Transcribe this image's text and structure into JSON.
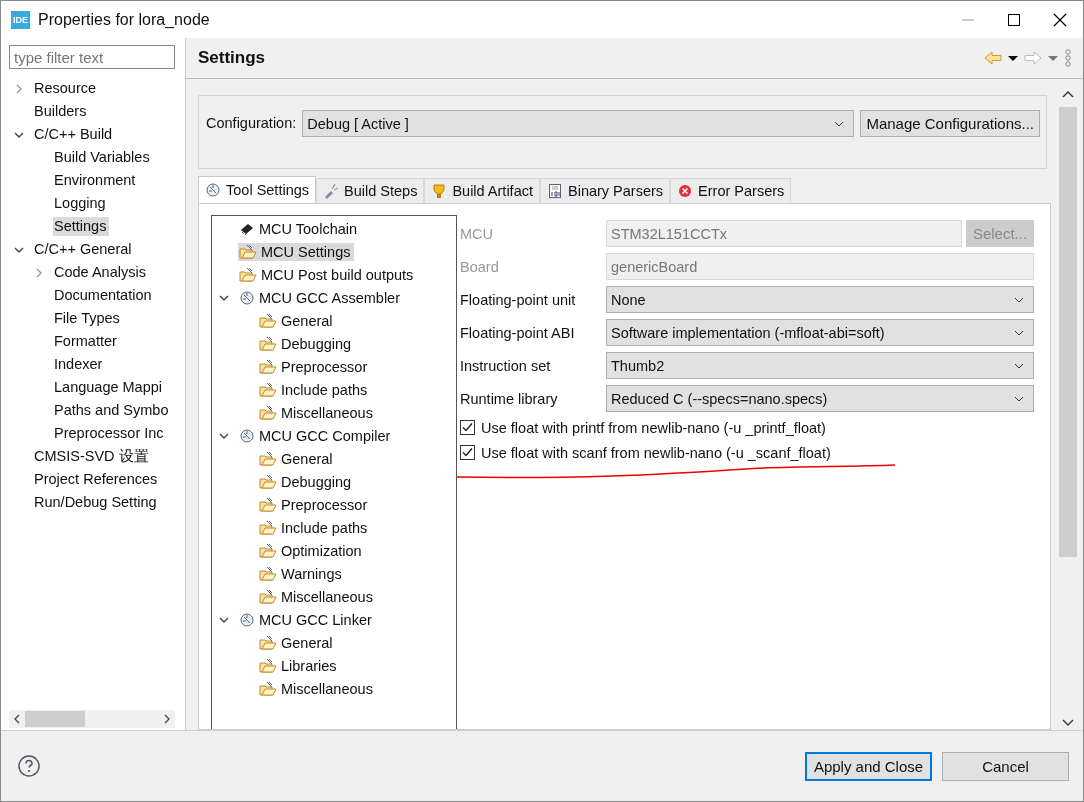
{
  "window": {
    "title": "Properties for lora_node",
    "app_icon": "IDE"
  },
  "sidebar": {
    "filter": {
      "placeholder": "type filter text"
    },
    "items": [
      {
        "label": "Resource",
        "selected": false,
        "expanded": false
      },
      {
        "label": "Builders",
        "selected": false
      },
      {
        "label": "C/C++ Build",
        "selected": false,
        "expanded": true,
        "children": [
          {
            "label": "Build Variables",
            "selected": false
          },
          {
            "label": "Environment",
            "selected": false
          },
          {
            "label": "Logging",
            "selected": false
          },
          {
            "label": "Settings",
            "selected": true
          }
        ]
      },
      {
        "label": "C/C++ General",
        "selected": false,
        "expanded": true,
        "children": [
          {
            "label": "Code Analysis",
            "selected": false,
            "expanded": false
          },
          {
            "label": "Documentation",
            "selected": false
          },
          {
            "label": "File Types",
            "selected": false
          },
          {
            "label": "Formatter",
            "selected": false
          },
          {
            "label": "Indexer",
            "selected": false
          },
          {
            "label": "Language Mappi",
            "selected": false
          },
          {
            "label": "Paths and Symbo",
            "selected": false
          },
          {
            "label": "Preprocessor Inc",
            "selected": false
          }
        ]
      },
      {
        "label": "CMSIS-SVD 设置",
        "selected": false
      },
      {
        "label": "Project References",
        "selected": false
      },
      {
        "label": "Run/Debug Setting",
        "selected": false
      }
    ]
  },
  "page": {
    "title": "Settings",
    "configuration": {
      "label": "Configuration:",
      "value": "Debug  [ Active ]",
      "button": "Manage Configurations..."
    },
    "tabs": [
      {
        "label": "Tool Settings",
        "kind": "gear",
        "selected": true
      },
      {
        "label": "Build Steps",
        "kind": "brush",
        "selected": false
      },
      {
        "label": "Build Artifact",
        "kind": "trophy",
        "selected": false
      },
      {
        "label": "Binary Parsers",
        "kind": "binary",
        "selected": false
      },
      {
        "label": "Error Parsers",
        "kind": "error",
        "selected": false
      }
    ],
    "tool_tree": [
      {
        "label": "MCU Toolchain",
        "kind": "chip",
        "selected": false
      },
      {
        "label": "MCU Settings",
        "kind": "folder",
        "selected": true
      },
      {
        "label": "MCU Post build outputs",
        "kind": "folder",
        "selected": false
      },
      {
        "label": "MCU GCC Assembler",
        "kind": "gear",
        "selected": false,
        "expanded": true,
        "children": [
          {
            "label": "General",
            "kind": "folder",
            "selected": false
          },
          {
            "label": "Debugging",
            "kind": "folder",
            "selected": false
          },
          {
            "label": "Preprocessor",
            "kind": "folder",
            "selected": false
          },
          {
            "label": "Include paths",
            "kind": "folder",
            "selected": false
          },
          {
            "label": "Miscellaneous",
            "kind": "folder",
            "selected": false
          }
        ]
      },
      {
        "label": "MCU GCC Compiler",
        "kind": "gear",
        "selected": false,
        "expanded": true,
        "children": [
          {
            "label": "General",
            "kind": "folder",
            "selected": false
          },
          {
            "label": "Debugging",
            "kind": "folder",
            "selected": false
          },
          {
            "label": "Preprocessor",
            "kind": "folder",
            "selected": false
          },
          {
            "label": "Include paths",
            "kind": "folder",
            "selected": false
          },
          {
            "label": "Optimization",
            "kind": "folder",
            "selected": false
          },
          {
            "label": "Warnings",
            "kind": "folder",
            "selected": false
          },
          {
            "label": "Miscellaneous",
            "kind": "folder",
            "selected": false
          }
        ]
      },
      {
        "label": "MCU GCC Linker",
        "kind": "gear",
        "selected": false,
        "expanded": true,
        "children": [
          {
            "label": "General",
            "kind": "folder",
            "selected": false
          },
          {
            "label": "Libraries",
            "kind": "folder",
            "selected": false
          },
          {
            "label": "Miscellaneous",
            "kind": "folder",
            "selected": false
          }
        ]
      }
    ],
    "fields": [
      {
        "kind": "text",
        "label": "MCU",
        "value": "STM32L151CCTx",
        "disabled": true,
        "button": "Select..."
      },
      {
        "kind": "text",
        "label": "Board",
        "value": "genericBoard",
        "disabled": true
      },
      {
        "kind": "select",
        "label": "Floating-point unit",
        "value": "None",
        "disabled": false
      },
      {
        "kind": "select",
        "label": "Floating-point ABI",
        "value": "Software implementation (-mfloat-abi=soft)",
        "disabled": false
      },
      {
        "kind": "select",
        "label": "Instruction set",
        "value": "Thumb2",
        "disabled": false
      },
      {
        "kind": "select",
        "label": "Runtime library",
        "value": "Reduced C (--specs=nano.specs)",
        "disabled": false
      }
    ],
    "checkboxes": [
      {
        "label": "Use float with printf from newlib-nano (-u _printf_float)",
        "checked": true
      },
      {
        "label": "Use float with scanf from newlib-nano (-u _scanf_float)",
        "checked": true
      }
    ]
  },
  "buttons": [
    {
      "label": "Apply and Close",
      "default": true
    },
    {
      "label": "Cancel",
      "default": false
    }
  ]
}
